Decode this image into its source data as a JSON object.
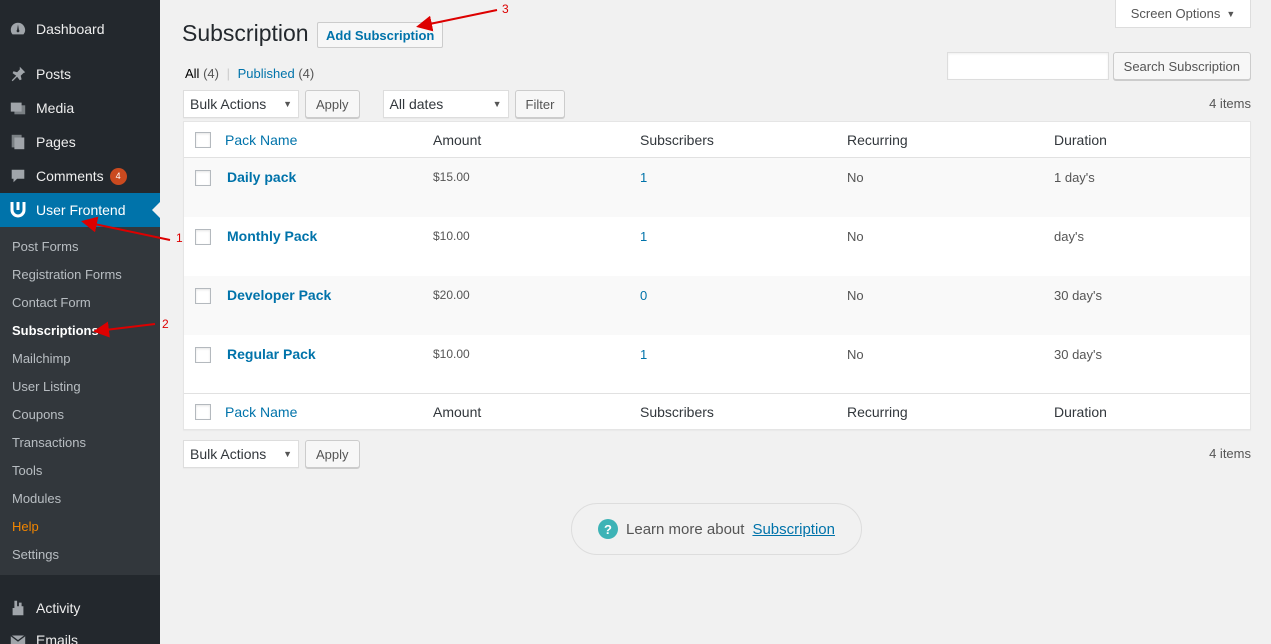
{
  "sidebar": {
    "items": [
      {
        "label": "Dashboard",
        "icon": "dashboard-icon"
      },
      {
        "label": "Posts",
        "icon": "pin-icon"
      },
      {
        "label": "Media",
        "icon": "media-icon"
      },
      {
        "label": "Pages",
        "icon": "pages-icon"
      },
      {
        "label": "Comments",
        "icon": "comment-icon",
        "badge": "4"
      },
      {
        "label": "User Frontend",
        "icon": "user-frontend-logo-icon"
      }
    ],
    "submenu": [
      "Post Forms",
      "Registration Forms",
      "Contact Form",
      "Subscriptions",
      "Mailchimp",
      "User Listing",
      "Coupons",
      "Transactions",
      "Tools",
      "Modules",
      "Help",
      "Settings"
    ],
    "bottom_items": [
      {
        "label": "Activity",
        "icon": "activity-icon"
      },
      {
        "label": "Emails",
        "icon": "email-icon"
      }
    ],
    "colors": {
      "active": "#0073aa",
      "help": "#f18500",
      "bg": "#23282d"
    }
  },
  "header": {
    "title": "Subscription",
    "add_button": "Add Subscription",
    "screen_options": "Screen Options"
  },
  "views": {
    "all_label": "All",
    "all_count": "(4)",
    "separator": "|",
    "published_label": "Published",
    "published_count": "(4)"
  },
  "search": {
    "button": "Search Subscription",
    "value": ""
  },
  "tablenav_top": {
    "bulk": "Bulk Actions",
    "apply": "Apply",
    "dates": "All dates",
    "filter": "Filter",
    "count": "4 items"
  },
  "tablenav_bottom": {
    "bulk": "Bulk Actions",
    "apply": "Apply",
    "count": "4 items"
  },
  "table": {
    "columns": [
      "Pack Name",
      "Amount",
      "Subscribers",
      "Recurring",
      "Duration"
    ],
    "rows": [
      {
        "name": "Daily pack",
        "amount": "$15.00",
        "subscribers": "1",
        "recurring": "No",
        "duration": "1 day's"
      },
      {
        "name": "Monthly Pack",
        "amount": "$10.00",
        "subscribers": "1",
        "recurring": "No",
        "duration": "day's"
      },
      {
        "name": "Developer Pack",
        "amount": "$20.00",
        "subscribers": "0",
        "recurring": "No",
        "duration": "30 day's"
      },
      {
        "name": "Regular Pack",
        "amount": "$10.00",
        "subscribers": "1",
        "recurring": "No",
        "duration": "30 day's"
      }
    ]
  },
  "learn_more": {
    "text": "Learn more about",
    "link": "Subscription"
  },
  "annotations": {
    "n1": "1",
    "n2": "2",
    "n3": "3",
    "color": "#dd0000"
  }
}
